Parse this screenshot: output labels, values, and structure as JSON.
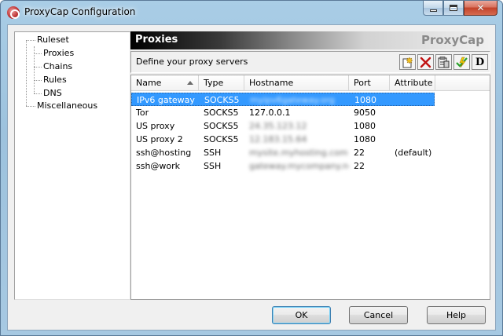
{
  "window": {
    "title": "ProxyCap Configuration"
  },
  "tree": {
    "items": [
      {
        "label": "Ruleset",
        "level": 0
      },
      {
        "label": "Proxies",
        "level": 1
      },
      {
        "label": "Chains",
        "level": 1
      },
      {
        "label": "Rules",
        "level": 1
      },
      {
        "label": "DNS",
        "level": 1
      },
      {
        "label": "Miscellaneous",
        "level": 0
      }
    ]
  },
  "panel": {
    "title": "Proxies",
    "brand": "ProxyCap",
    "description": "Define your proxy servers",
    "toolbar_icons": [
      "new-proxy-icon",
      "delete-icon",
      "properties-icon",
      "check-icon",
      "d-icon"
    ],
    "d_label": "D"
  },
  "list": {
    "columns": [
      "Name",
      "Type",
      "Hostname",
      "Port",
      "Attribute"
    ],
    "rows": [
      {
        "name": "IPv6 gateway",
        "type": "SOCKS5",
        "hostname": "myipv6gateway.org",
        "port": "1080",
        "attribute": "",
        "selected": true,
        "blurred": true
      },
      {
        "name": "Tor",
        "type": "SOCKS5",
        "hostname": "127.0.0.1",
        "port": "9050",
        "attribute": "",
        "selected": false,
        "blurred": false
      },
      {
        "name": "US proxy",
        "type": "SOCKS5",
        "hostname": "24.35.123.12",
        "port": "1080",
        "attribute": "",
        "selected": false,
        "blurred": true
      },
      {
        "name": "US proxy 2",
        "type": "SOCKS5",
        "hostname": "12.183.15.64",
        "port": "1080",
        "attribute": "",
        "selected": false,
        "blurred": true
      },
      {
        "name": "ssh@hosting",
        "type": "SSH",
        "hostname": "mysite.myhosting.com",
        "port": "22",
        "attribute": "(default)",
        "selected": false,
        "blurred": true
      },
      {
        "name": "ssh@work",
        "type": "SSH",
        "hostname": "gateway.mycompany.net",
        "port": "22",
        "attribute": "",
        "selected": false,
        "blurred": true
      }
    ]
  },
  "buttons": {
    "ok": "OK",
    "cancel": "Cancel",
    "help": "Help"
  }
}
